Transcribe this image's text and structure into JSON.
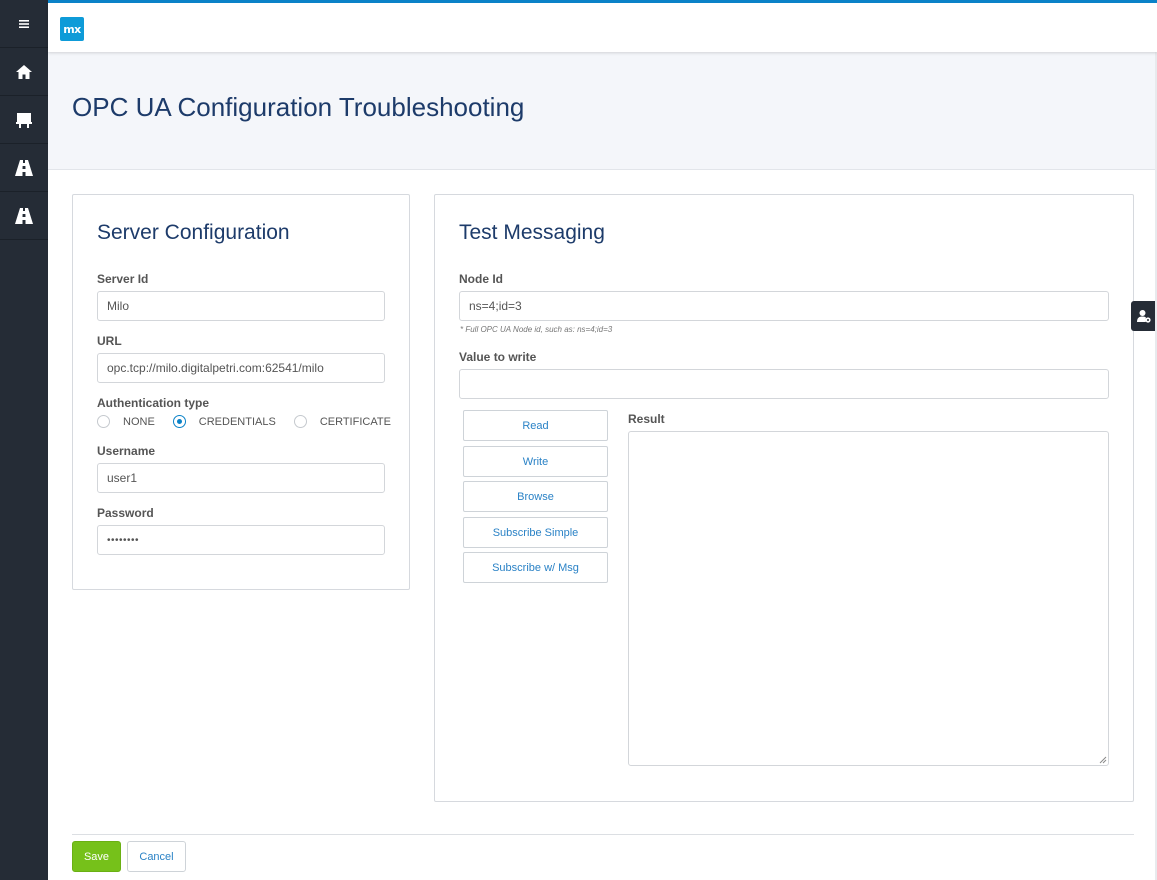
{
  "app": {
    "logo_text": "mx",
    "brand_color": "#0a82c8"
  },
  "sidebar": {
    "items": [
      {
        "icon": "menu-icon"
      },
      {
        "icon": "home-icon"
      },
      {
        "icon": "presentation-icon"
      },
      {
        "icon": "road-icon"
      },
      {
        "icon": "road-icon"
      }
    ]
  },
  "page": {
    "title": "OPC UA Configuration Troubleshooting"
  },
  "server_config": {
    "title": "Server Configuration",
    "server_id_label": "Server Id",
    "server_id_value": "Milo",
    "url_label": "URL",
    "url_value": "opc.tcp://milo.digitalpetri.com:62541/milo",
    "auth_label": "Authentication type",
    "auth_options": [
      "NONE",
      "CREDENTIALS",
      "CERTIFICATE"
    ],
    "auth_selected": "CREDENTIALS",
    "username_label": "Username",
    "username_value": "user1",
    "password_label": "Password",
    "password_value": "••••••••"
  },
  "test_messaging": {
    "title": "Test Messaging",
    "node_id_label": "Node Id",
    "node_id_value": "ns=4;id=3",
    "node_id_help": "* Full OPC UA Node id, such as: ns=4;id=3",
    "value_label": "Value to write",
    "value_value": "",
    "result_label": "Result",
    "buttons": [
      "Read",
      "Write",
      "Browse",
      "Subscribe Simple",
      "Subscribe w/ Msg"
    ]
  },
  "footer": {
    "save_label": "Save",
    "cancel_label": "Cancel"
  },
  "colors": {
    "sidebar_bg": "#252c36",
    "title_color": "#1d3b6a",
    "save_green": "#76c11a",
    "link_blue": "#2a82c6"
  }
}
